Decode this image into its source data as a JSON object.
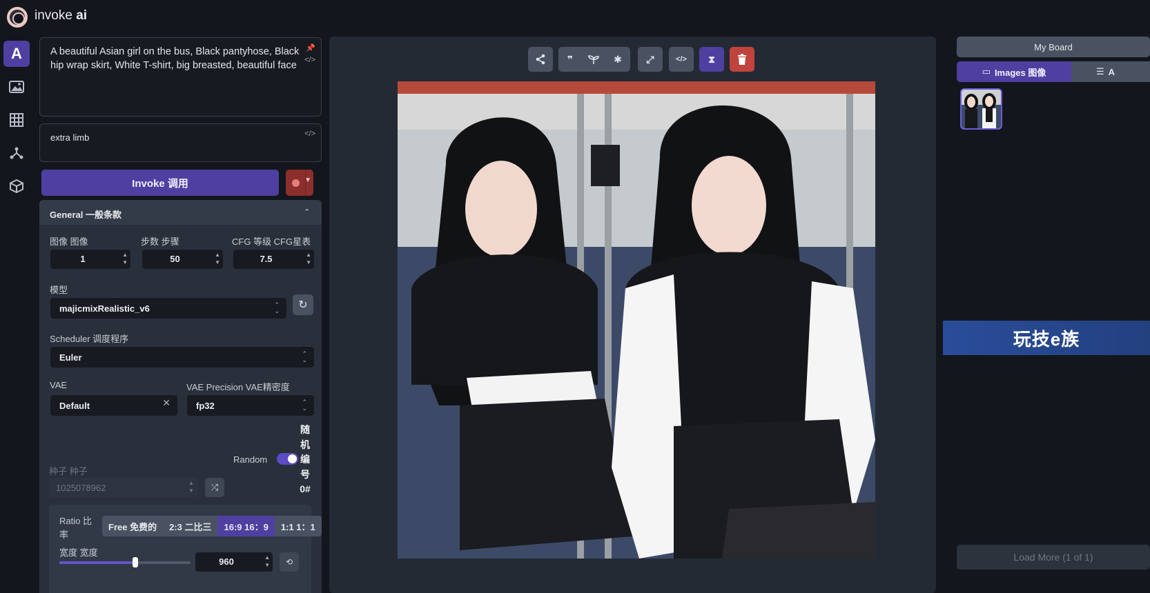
{
  "app": {
    "title_light": "invoke ",
    "title_bold": "ai"
  },
  "sidebar": {
    "items": [
      {
        "name": "text-to-image",
        "glyph": "A"
      },
      {
        "name": "image-to-image",
        "glyph": "▨"
      },
      {
        "name": "unified-canvas",
        "glyph": "▦"
      },
      {
        "name": "nodes",
        "glyph": "⋔"
      },
      {
        "name": "model-manager",
        "glyph": "⬢"
      }
    ]
  },
  "prompt": {
    "positive": "A beautiful Asian girl on the bus, Black pantyhose, Black hip wrap skirt, White T-shirt, big breasted, beautiful face",
    "negative": "extra limb"
  },
  "actions": {
    "invoke_label": "Invoke 调用"
  },
  "general": {
    "title": "General 一般条款",
    "images_label": "图像 图像",
    "images_value": "1",
    "steps_label": "步数 步骤",
    "steps_value": "50",
    "cfg_label": "CFG 等级 CFG星表",
    "cfg_value": "7.5",
    "model_label": "模型",
    "model_value": "majicmixRealistic_v6",
    "scheduler_label": "Scheduler 调度程序",
    "scheduler_value": "Euler",
    "vae_label": "VAE",
    "vae_value": "Default",
    "vae_precision_label": "VAE Precision VAE精密度",
    "vae_precision_value": "fp32",
    "random_label": "Random",
    "random_cjk": "随机编号0#",
    "random_enabled": true,
    "seed_label": "种子 种子",
    "seed_value": "1025078962",
    "ratio_label": "Ratio 比率",
    "ratios": [
      "Free 免费的",
      "2:3 二比三",
      "16:9 16：9",
      "1:1 1：1"
    ],
    "ratio_selected": "16:9 16：9",
    "width_label": "宽度 宽度",
    "width_value": "960",
    "width_slider_fraction": 0.58
  },
  "colors": {
    "accent": "#4f3fa0",
    "danger": "#c0433d",
    "panel": "#2a303b",
    "background": "#13161c"
  },
  "viewer": {
    "toolbar": [
      {
        "name": "share-icon",
        "glyph": "⋖"
      },
      {
        "name": "quote-icon",
        "glyph": "❞"
      },
      {
        "name": "seedling-icon",
        "glyph": "ᛘ"
      },
      {
        "name": "asterisk-icon",
        "glyph": "✱"
      },
      {
        "name": "expand-icon",
        "glyph": "⤢"
      },
      {
        "name": "code-icon",
        "glyph": "</>"
      },
      {
        "name": "hourglass-icon",
        "glyph": "⧗"
      },
      {
        "name": "trash-icon",
        "glyph": "🗑"
      }
    ]
  },
  "gallery": {
    "board_label": "My Board",
    "images_tab": "Images 图像",
    "assets_tab": "A",
    "load_more": "Load More (1 of 1)",
    "watermark": "玩技e族"
  }
}
